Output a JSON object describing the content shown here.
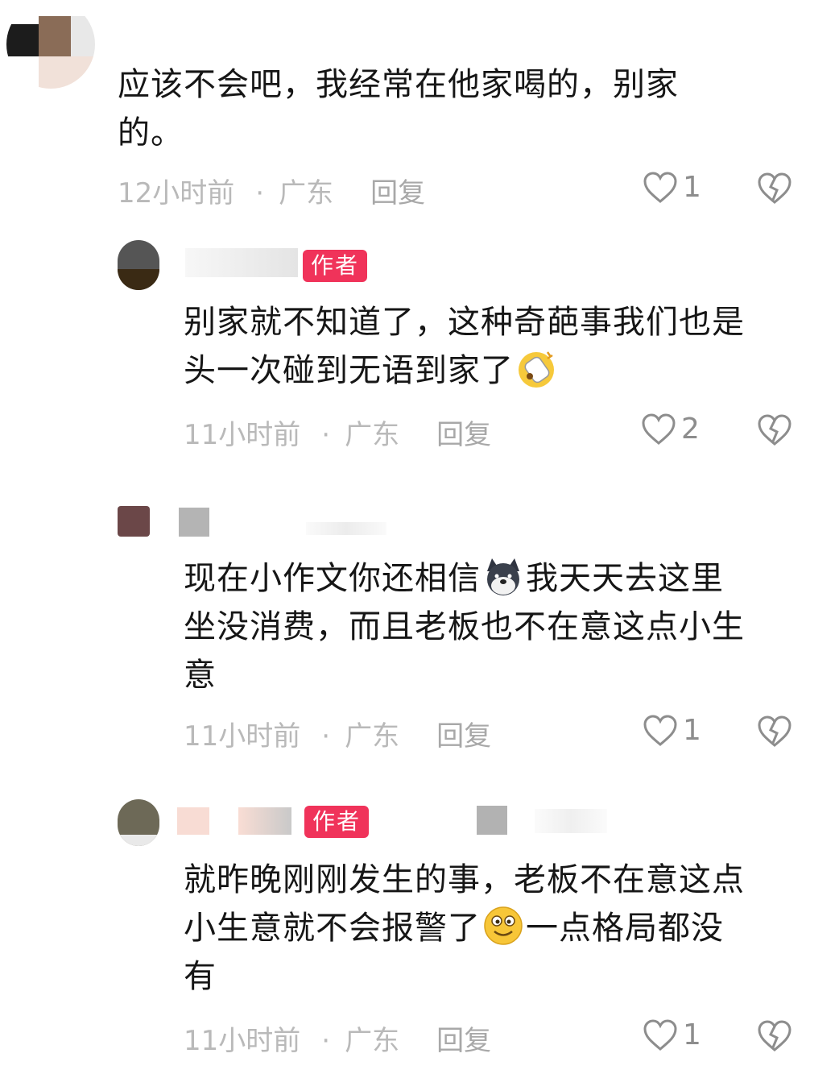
{
  "comments": [
    {
      "text": "应该不会吧，我经常在他家喝的，别家的。",
      "line1": "应该不会吧，我经常在他家喝的，别家",
      "line2": "的。",
      "time": "12小时前",
      "location": "广东",
      "reply": "回复",
      "likes": "1"
    },
    {
      "author_tag": "作者",
      "line1": "别家就不知道了，这种奇葩事我们也是",
      "line2": "头一次碰到无语到家了",
      "emoji": "shocked-emoji",
      "time": "11小时前",
      "location": "广东",
      "reply": "回复",
      "likes": "2"
    },
    {
      "line1a": "现在小作文你还相信",
      "emoji": "doge-emoji",
      "line1b": "我天天去这里",
      "line2": "坐没消费，而且老板也不在意这点小生",
      "line3": "意",
      "time": "11小时前",
      "location": "广东",
      "reply": "回复",
      "likes": "1"
    },
    {
      "author_tag": "作者",
      "line1": "就昨晚刚刚发生的事，老板不在意这点",
      "line2a": "小生意就不会报警了",
      "emoji": "smile-emoji",
      "line2b": "一点格局都没",
      "line3": "有",
      "time": "11小时前",
      "location": "广东",
      "reply": "回复",
      "likes": "1"
    }
  ],
  "meta_separator": "·",
  "colors": {
    "author_tag": "#f0335a",
    "meta": "#b9b9b9",
    "text": "#161616"
  }
}
